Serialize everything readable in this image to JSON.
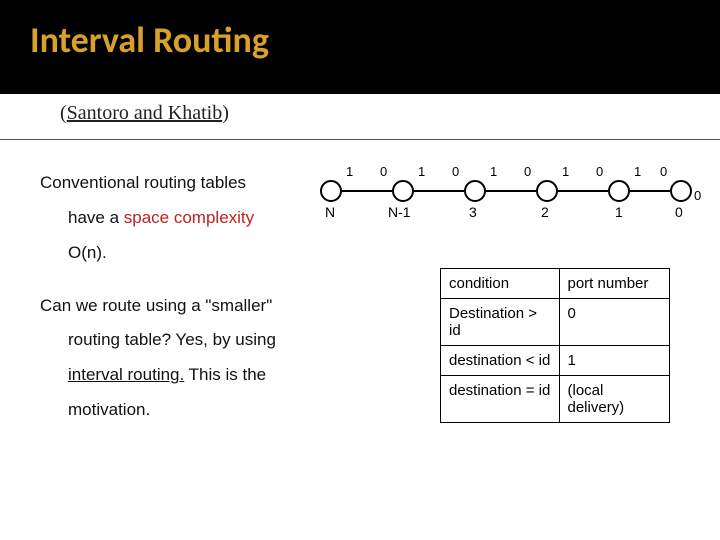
{
  "title": "Interval Routing",
  "subtitle_open": "(",
  "subtitle_text": "Santoro and Khatib",
  "subtitle_close": ")",
  "para1_a": "Conventional routing tables",
  "para1_b": "have a ",
  "para1_c": "space complexity",
  "para1_d": "O(n).",
  "para2_a": "Can we route using a \"smaller\"",
  "para2_b": "routing table? Yes, by using",
  "para2_c": "interval routing.",
  "para2_d": " This is the",
  "para2_e": "motivation.",
  "diagram": {
    "nodes": [
      "N",
      "N-1",
      "3",
      "2",
      "1",
      "0"
    ],
    "ports_out": [
      "1",
      "1",
      "1",
      "1",
      "1"
    ],
    "ports_in": [
      "0",
      "0",
      "0",
      "0",
      "0"
    ],
    "right_port": "0"
  },
  "table": {
    "header_cond": "condition",
    "header_port": "port number",
    "r1c1": "Destination > id",
    "r1c2": "0",
    "r2c1": "destination < id",
    "r2c2": "1",
    "r3c1": "destination = id",
    "r3c2": "(local delivery)"
  },
  "chart_data": {
    "type": "table",
    "title": "Interval routing port selection",
    "columns": [
      "condition",
      "port number"
    ],
    "rows": [
      [
        "Destination > id",
        "0"
      ],
      [
        "destination < id",
        "1"
      ],
      [
        "destination = id",
        "(local delivery)"
      ]
    ],
    "diagram_nodes": [
      "N",
      "N-1",
      "3",
      "2",
      "1",
      "0"
    ],
    "diagram_edge_ports_left": [
      1,
      1,
      1,
      1,
      1
    ],
    "diagram_edge_ports_right": [
      0,
      0,
      0,
      0,
      0
    ],
    "rightmost_self_port": 0
  }
}
